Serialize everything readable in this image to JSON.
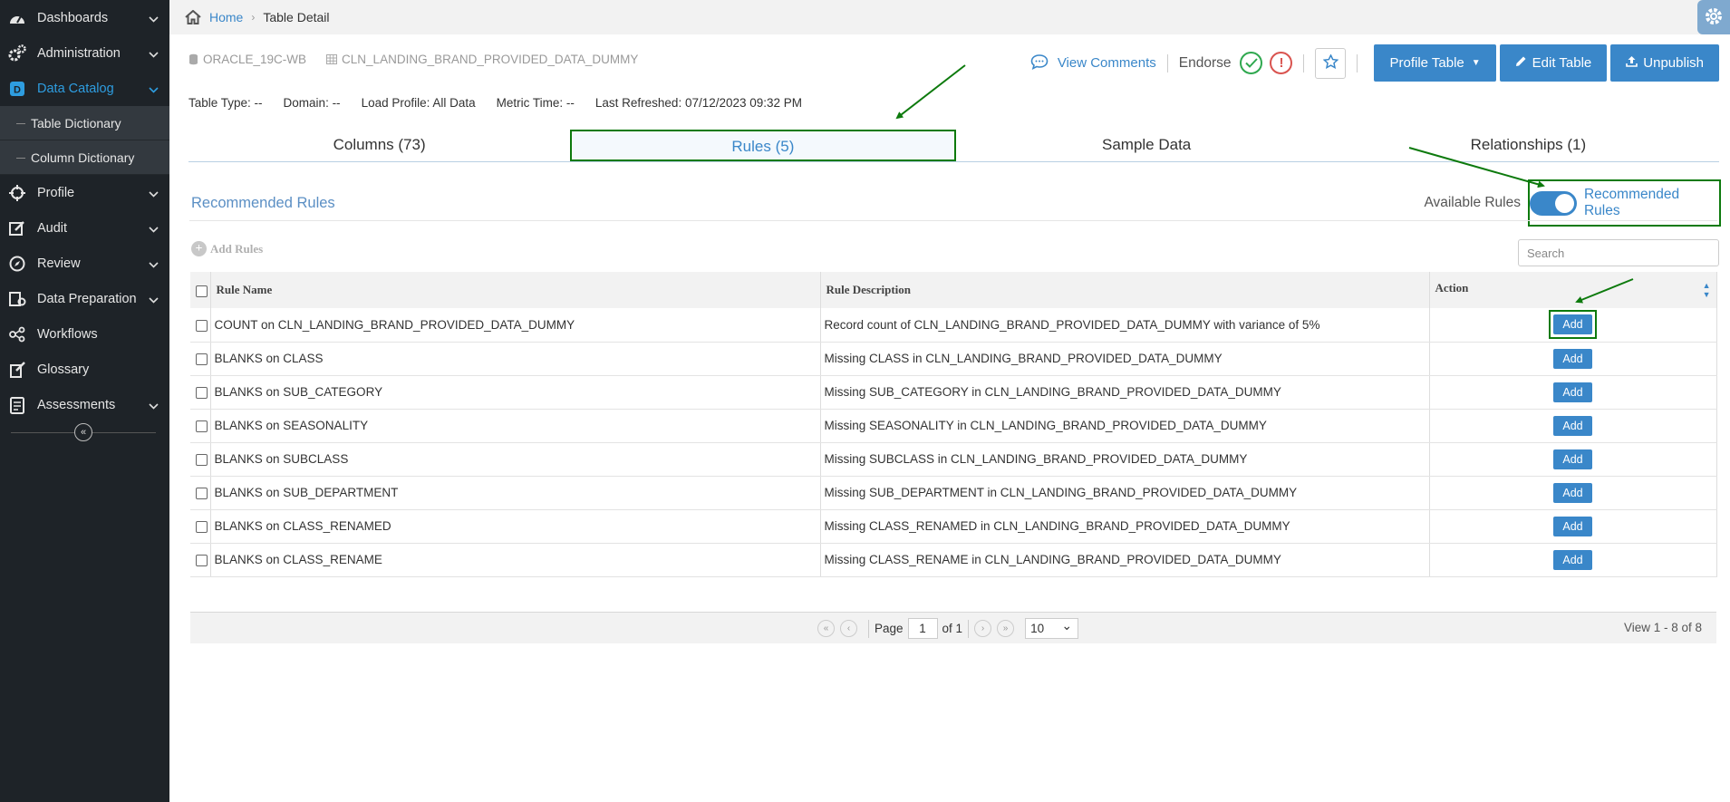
{
  "sidebar": {
    "items": [
      {
        "label": "Dashboards",
        "icon": "dashboard-icon"
      },
      {
        "label": "Administration",
        "icon": "gears-icon"
      },
      {
        "label": "Data Catalog",
        "icon": "catalog-icon"
      },
      {
        "label": "Profile",
        "icon": "crosshair-icon"
      },
      {
        "label": "Audit",
        "icon": "edit-icon"
      },
      {
        "label": "Review",
        "icon": "compass-icon"
      },
      {
        "label": "Data Preparation",
        "icon": "preparation-icon"
      },
      {
        "label": "Workflows",
        "icon": "workflow-icon"
      },
      {
        "label": "Glossary",
        "icon": "glossary-icon"
      },
      {
        "label": "Assessments",
        "icon": "assessment-icon"
      }
    ],
    "sub_items": [
      "Table Dictionary",
      "Column Dictionary"
    ]
  },
  "breadcrumb": {
    "home": "Home",
    "current": "Table Detail"
  },
  "path": {
    "database": "ORACLE_19C-WB",
    "table": "CLN_LANDING_BRAND_PROVIDED_DATA_DUMMY"
  },
  "actions": {
    "view_comments": "View Comments",
    "endorse": "Endorse",
    "warn_symbol": "!",
    "profile_table": "Profile Table",
    "edit_table": "Edit Table",
    "unpublish": "Unpublish"
  },
  "meta": {
    "table_type": "Table Type: --",
    "domain": "Domain: --",
    "load_profile": "Load Profile: All Data",
    "metric_time": "Metric Time: --",
    "last_refreshed": "Last Refreshed: 07/12/2023 09:32 PM"
  },
  "tabs": [
    "Columns (73)",
    "Rules (5)",
    "Sample Data",
    "Relationships (1)"
  ],
  "section": {
    "title": "Recommended Rules",
    "available_label": "Available Rules",
    "recommended_label": "Recommended Rules",
    "add_rules": "Add Rules",
    "search_placeholder": "Search"
  },
  "table": {
    "headers": [
      "Rule Name",
      "Rule Description",
      "Action"
    ],
    "action_label": "Add",
    "rows": [
      {
        "name": "COUNT on CLN_LANDING_BRAND_PROVIDED_DATA_DUMMY",
        "desc": "Record count of CLN_LANDING_BRAND_PROVIDED_DATA_DUMMY with variance of 5%"
      },
      {
        "name": "BLANKS on CLASS",
        "desc": "Missing CLASS in CLN_LANDING_BRAND_PROVIDED_DATA_DUMMY"
      },
      {
        "name": "BLANKS on SUB_CATEGORY",
        "desc": "Missing SUB_CATEGORY in CLN_LANDING_BRAND_PROVIDED_DATA_DUMMY"
      },
      {
        "name": "BLANKS on SEASONALITY",
        "desc": "Missing SEASONALITY in CLN_LANDING_BRAND_PROVIDED_DATA_DUMMY"
      },
      {
        "name": "BLANKS on SUBCLASS",
        "desc": "Missing SUBCLASS in CLN_LANDING_BRAND_PROVIDED_DATA_DUMMY"
      },
      {
        "name": "BLANKS on SUB_DEPARTMENT",
        "desc": "Missing SUB_DEPARTMENT in CLN_LANDING_BRAND_PROVIDED_DATA_DUMMY"
      },
      {
        "name": "BLANKS on CLASS_RENAMED",
        "desc": "Missing CLASS_RENAMED in CLN_LANDING_BRAND_PROVIDED_DATA_DUMMY"
      },
      {
        "name": "BLANKS on CLASS_RENAME",
        "desc": "Missing CLASS_RENAME in CLN_LANDING_BRAND_PROVIDED_DATA_DUMMY"
      }
    ]
  },
  "pager": {
    "page_label": "Page",
    "page": "1",
    "of_label": "of 1",
    "page_size": "10",
    "view_info": "View 1 - 8 of 8"
  },
  "colors": {
    "accent": "#3a87c9",
    "sidebar_bg": "#1e2328",
    "highlight": "#0d7a0d"
  }
}
